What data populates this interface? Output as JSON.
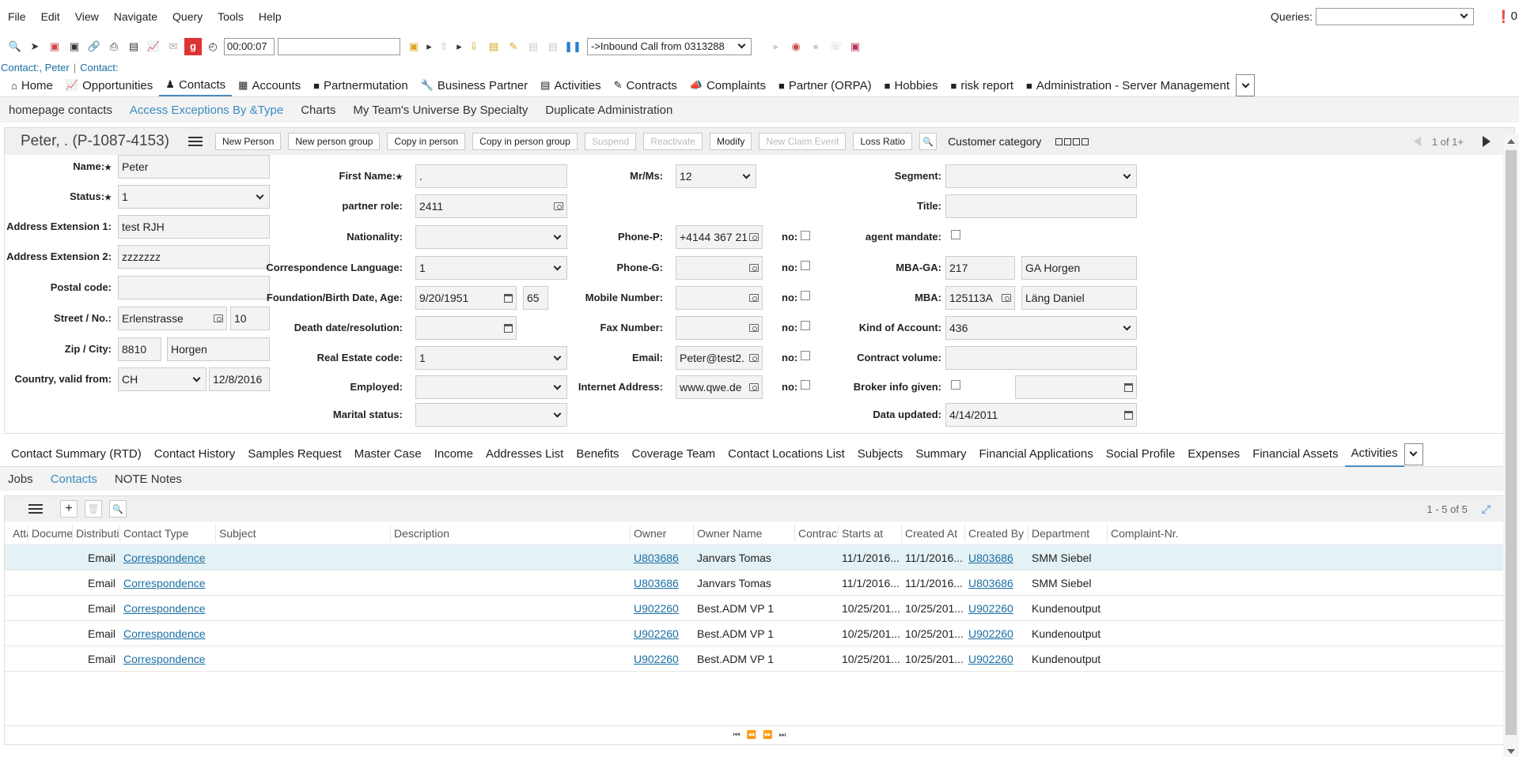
{
  "menu": [
    "File",
    "Edit",
    "View",
    "Navigate",
    "Query",
    "Tools",
    "Help"
  ],
  "queries_label": "Queries:",
  "queries_value": "",
  "notif_count": "0",
  "toolbar": {
    "timer": "00:00:07",
    "search_value": "",
    "call_select": "->Inbound Call from 0313288"
  },
  "breadcrumb": {
    "item1": "Contact:, Peter",
    "sep": "|",
    "item2": "Contact:"
  },
  "mainnav": [
    {
      "label": "Home",
      "icon": "home-icon"
    },
    {
      "label": "Opportunities",
      "icon": "chart-icon"
    },
    {
      "label": "Contacts",
      "icon": "person-icon"
    },
    {
      "label": "Accounts",
      "icon": "building-icon"
    },
    {
      "label": "Partnermutation",
      "icon": "book-icon"
    },
    {
      "label": "Business Partner",
      "icon": "wrench-icon"
    },
    {
      "label": "Activities",
      "icon": "clipboard-icon"
    },
    {
      "label": "Contracts",
      "icon": "contract-icon"
    },
    {
      "label": "Complaints",
      "icon": "megaphone-icon"
    },
    {
      "label": "Partner (ORPA)",
      "icon": "book-icon"
    },
    {
      "label": "Hobbies",
      "icon": "book-icon"
    },
    {
      "label": "risk report",
      "icon": "book-icon"
    },
    {
      "label": "Administration - Server Management",
      "icon": "book-icon"
    }
  ],
  "subnav": [
    "homepage contacts",
    "Access Exceptions By &Type",
    "Charts",
    "My Team's Universe By Specialty",
    "Duplicate Administration"
  ],
  "record": {
    "title": "Peter, . (P-1087-4153)",
    "buttons": [
      "New Person",
      "New person group",
      "Copy in person",
      "Copy in person group",
      "Suspend",
      "Reactivate",
      "Modify",
      "New Claim Event",
      "Loss Ratio"
    ],
    "customer_category_label": "Customer category",
    "pager": "1 of 1+"
  },
  "form": {
    "name": {
      "label": "Name:",
      "value": "Peter"
    },
    "status": {
      "label": "Status:",
      "value": "1"
    },
    "addr_ext1": {
      "label": "Address Extension 1:",
      "value": "test RJH"
    },
    "addr_ext2": {
      "label": "Address Extension 2:",
      "value": "zzzzzzz"
    },
    "postal_code": {
      "label": "Postal code:",
      "value": ""
    },
    "street": {
      "label": "Street / No.:",
      "value": "Erlenstrasse",
      "no": "10"
    },
    "zip_city": {
      "label": "Zip / City:",
      "zip": "8810",
      "city": "Horgen"
    },
    "country": {
      "label": "Country, valid from:",
      "value": "CH",
      "date": "12/8/2016"
    },
    "first_name": {
      "label": "First Name:",
      "value": "."
    },
    "partner_role": {
      "label": "partner role:",
      "value": "2411"
    },
    "nationality": {
      "label": "Nationality:",
      "value": ""
    },
    "corr_lang": {
      "label": "Correspondence Language:",
      "value": "1"
    },
    "birth": {
      "label": "Foundation/Birth Date, Age:",
      "value": "9/20/1951",
      "age": "65"
    },
    "death": {
      "label": "Death date/resolution:",
      "value": ""
    },
    "real_estate": {
      "label": "Real Estate code:",
      "value": "1"
    },
    "employed": {
      "label": "Employed:",
      "value": ""
    },
    "marital": {
      "label": "Marital status:",
      "value": ""
    },
    "mrms": {
      "label": "Mr/Ms:",
      "value": "12"
    },
    "phone_p": {
      "label": "Phone-P:",
      "value": "+4144 367 21"
    },
    "phone_g": {
      "label": "Phone-G:",
      "value": ""
    },
    "mobile": {
      "label": "Mobile Number:",
      "value": ""
    },
    "fax": {
      "label": "Fax Number:",
      "value": ""
    },
    "email": {
      "label": "Email:",
      "value": "Peter@test2."
    },
    "internet": {
      "label": "Internet Address:",
      "value": "www.qwe.de"
    },
    "no_label": "no:",
    "segment": {
      "label": "Segment:",
      "value": ""
    },
    "title_f": {
      "label": "Title:",
      "value": ""
    },
    "agent_mandate": {
      "label": "agent mandate:"
    },
    "mba_ga": {
      "label": "MBA-GA:",
      "value": "217",
      "name": "GA Horgen"
    },
    "mba": {
      "label": "MBA:",
      "value": "125113A",
      "name": "Läng Daniel"
    },
    "kind_account": {
      "label": "Kind of Account:",
      "value": "436"
    },
    "contract_volume": {
      "label": "Contract volume:",
      "value": ""
    },
    "broker_info": {
      "label": "Broker info given:",
      "value": ""
    },
    "data_updated": {
      "label": "Data updated:",
      "value": "4/14/2011"
    }
  },
  "detail_tabs": [
    "Contact Summary (RTD)",
    "Contact History",
    "Samples Request",
    "Master Case",
    "Income",
    "Addresses List",
    "Benefits",
    "Coverage Team",
    "Contact Locations List",
    "Subjects",
    "Summary",
    "Financial Applications",
    "Social Profile",
    "Expenses",
    "Financial Assets",
    "Activities"
  ],
  "detail_sub": [
    "Jobs",
    "Contacts",
    "NOTE Notes"
  ],
  "grid": {
    "pager": "1 - 5 of 5",
    "columns": [
      "Atta",
      "Docume",
      "Distributi",
      "Contact Type",
      "Subject",
      "Description",
      "Owner",
      "Owner Name",
      "Contract",
      "Starts at",
      "Created At",
      "Created By",
      "Department",
      "Complaint-Nr."
    ],
    "rows": [
      {
        "dist": "Email",
        "type": "Correspondence",
        "owner": "U803686",
        "owner_name": "Janvars Tomas",
        "starts": "11/1/2016...",
        "created": "11/1/2016...",
        "created_by": "U803686",
        "dept": "SMM Siebel"
      },
      {
        "dist": "Email",
        "type": "Correspondence",
        "owner": "U803686",
        "owner_name": "Janvars Tomas",
        "starts": "11/1/2016...",
        "created": "11/1/2016...",
        "created_by": "U803686",
        "dept": "SMM Siebel"
      },
      {
        "dist": "Email",
        "type": "Correspondence",
        "owner": "U902260",
        "owner_name": "Best.ADM VP 1",
        "starts": "10/25/201...",
        "created": "10/25/201...",
        "created_by": "U902260",
        "dept": "Kundenoutput"
      },
      {
        "dist": "Email",
        "type": "Correspondence",
        "owner": "U902260",
        "owner_name": "Best.ADM VP 1",
        "starts": "10/25/201...",
        "created": "10/25/201...",
        "created_by": "U902260",
        "dept": "Kundenoutput"
      },
      {
        "dist": "Email",
        "type": "Correspondence",
        "owner": "U902260",
        "owner_name": "Best.ADM VP 1",
        "starts": "10/25/201...",
        "created": "10/25/201...",
        "created_by": "U902260",
        "dept": "Kundenoutput"
      }
    ]
  }
}
